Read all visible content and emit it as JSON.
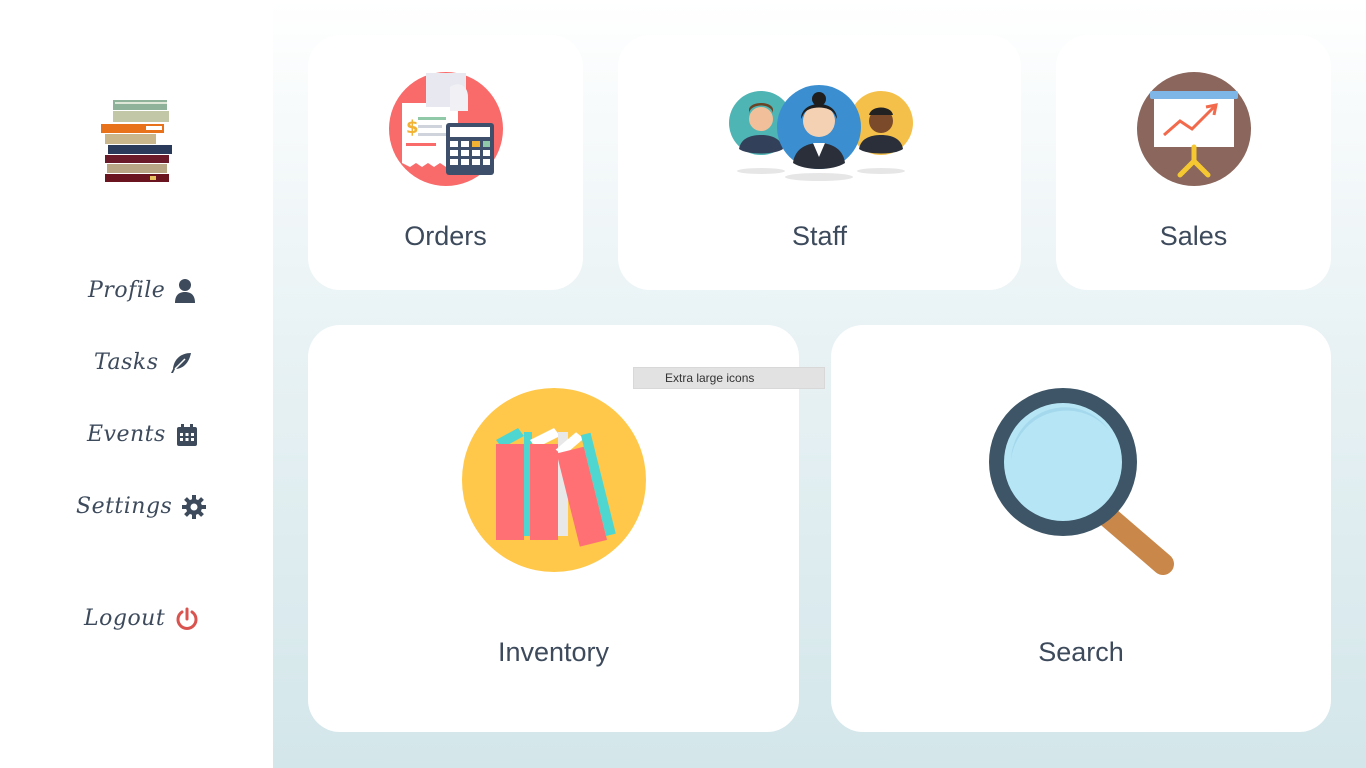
{
  "sidebar": {
    "items": [
      {
        "label": "Profile",
        "icon": "user-icon"
      },
      {
        "label": "Tasks",
        "icon": "feather-icon"
      },
      {
        "label": "Events",
        "icon": "calendar-icon"
      },
      {
        "label": "Settings",
        "icon": "gear-icon"
      }
    ],
    "logout": {
      "label": "Logout",
      "icon": "power-icon",
      "color": "#d9534f"
    }
  },
  "cards": {
    "orders": {
      "label": "Orders"
    },
    "staff": {
      "label": "Staff"
    },
    "sales": {
      "label": "Sales"
    },
    "inventory": {
      "label": "Inventory"
    },
    "search": {
      "label": "Search"
    }
  },
  "tooltip": {
    "text": "Extra large icons"
  },
  "colors": {
    "text": "#3d4a5c",
    "logout_icon": "#d9534f",
    "inventory_circle": "#ffc84a",
    "orders_circle": "#f96a6a",
    "sales_circle": "#8a665c",
    "search_lens": "#3d5566"
  }
}
